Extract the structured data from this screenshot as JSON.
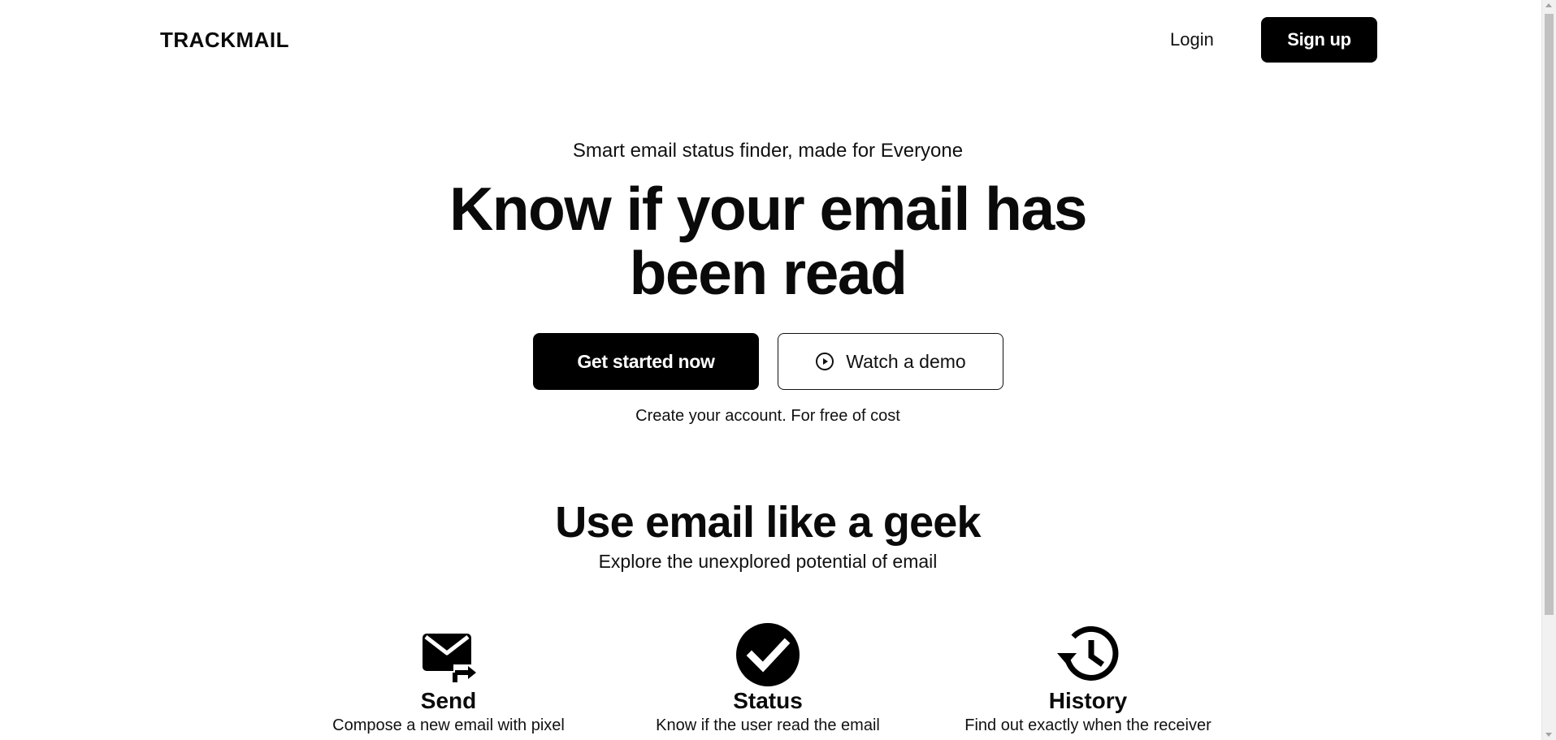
{
  "header": {
    "brand": "TRACKMAIL",
    "login_label": "Login",
    "signup_label": "Sign up"
  },
  "hero": {
    "eyebrow": "Smart email status finder, made for Everyone",
    "title_line1": "Know if your email has",
    "title_line2": "been read",
    "primary_cta": "Get started now",
    "secondary_cta": "Watch a demo",
    "secondary_cta_icon": "play-circle-icon",
    "note": "Create your account. For free of cost"
  },
  "section": {
    "title": "Use email like a geek",
    "subtitle": "Explore the unexplored potential of email"
  },
  "features": [
    {
      "icon": "send-mail-icon",
      "title": "Send",
      "desc": "Compose a new email with pixel"
    },
    {
      "icon": "check-circle-icon",
      "title": "Status",
      "desc": "Know if the user read the email"
    },
    {
      "icon": "history-icon",
      "title": "History",
      "desc": "Find out exactly when the receiver"
    }
  ],
  "colors": {
    "primary": "#000000",
    "background": "#ffffff",
    "text": "#0a0a0a"
  }
}
